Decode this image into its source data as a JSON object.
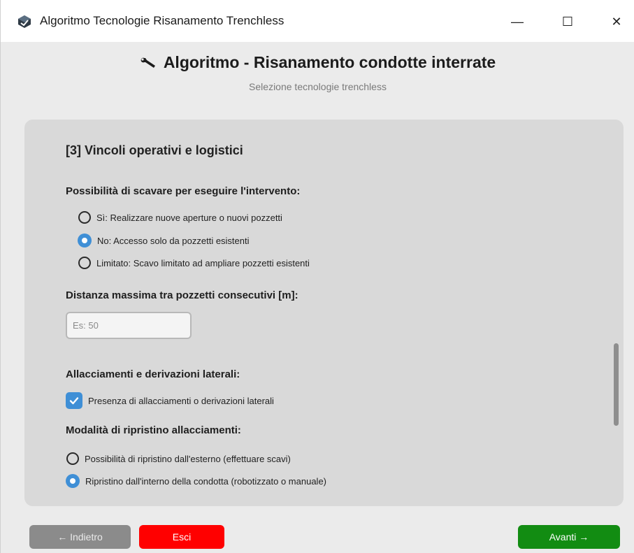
{
  "window": {
    "title": "Algoritmo Tecnologie Risanamento Trenchless",
    "minimize": "—",
    "maximize": "☐",
    "close": "✕"
  },
  "header": {
    "title": "Algoritmo - Risanamento condotte interrate",
    "subtitle": "Selezione tecnologie trenchless",
    "icon": "wrench-icon"
  },
  "section": {
    "title": "[3] Vincoli operativi e logistici"
  },
  "excavation": {
    "label": "Possibilità di scavare per eseguire l'intervento:",
    "options": [
      {
        "label": "Sì: Realizzare nuove aperture o nuovi pozzetti",
        "selected": false
      },
      {
        "label": "No: Accesso solo da pozzetti esistenti",
        "selected": true
      },
      {
        "label": "Limitato: Scavo limitato ad ampliare pozzetti esistenti",
        "selected": false
      }
    ]
  },
  "distance": {
    "label": "Distanza massima tra pozzetti consecutivi [m]:",
    "value": "",
    "placeholder": "Es: 50"
  },
  "laterals": {
    "label": "Allacciamenti e derivazioni laterali:",
    "checkbox_label": "Presenza di allacciamenti o derivazioni laterali",
    "checked": true
  },
  "restore": {
    "label": "Modalità di ripristino allacciamenti:",
    "options": [
      {
        "label": "Possibilità di ripristino dall'esterno (effettuare scavi)",
        "selected": false
      },
      {
        "label": "Ripristino dall'interno della condotta (robotizzato o manuale)",
        "selected": true
      }
    ]
  },
  "footer": {
    "back_label": "← Indietro",
    "exit_label": "Esci",
    "next_label": "Avanti →"
  },
  "colors": {
    "accent": "#3f8fd6",
    "exit": "#ff0000",
    "next": "#128c12",
    "back": "#8b8b8b"
  }
}
